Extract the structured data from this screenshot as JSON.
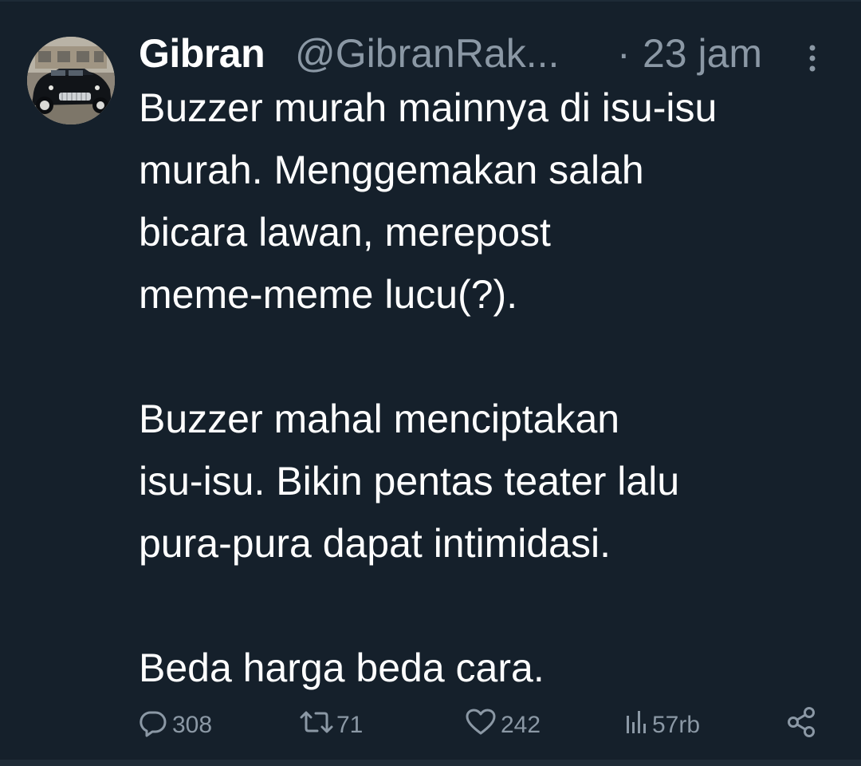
{
  "tweet": {
    "display_name": "Gibran",
    "handle": "@GibranRak...",
    "separator": "·",
    "time": "23 jam",
    "body": [
      "Buzzer murah mainnya di isu-isu",
      "murah. Menggemakan salah",
      "bicara lawan, merepost",
      "meme-meme lucu(?).",
      "Buzzer mahal menciptakan",
      "isu-isu. Bikin pentas teater lalu",
      "pura-pura dapat intimidasi.",
      "Beda harga beda cara."
    ]
  },
  "actions": {
    "replies": "308",
    "reposts": "71",
    "likes": "242",
    "views": "57rb"
  },
  "icons": {
    "more": "more-vertical-icon",
    "reply": "reply-icon",
    "repost": "repost-icon",
    "like": "heart-icon",
    "views": "views-chart-icon",
    "share": "share-icon"
  },
  "colors": {
    "background": "#15202b",
    "primary_text": "#ffffff",
    "secondary_text": "#8b98a5"
  }
}
